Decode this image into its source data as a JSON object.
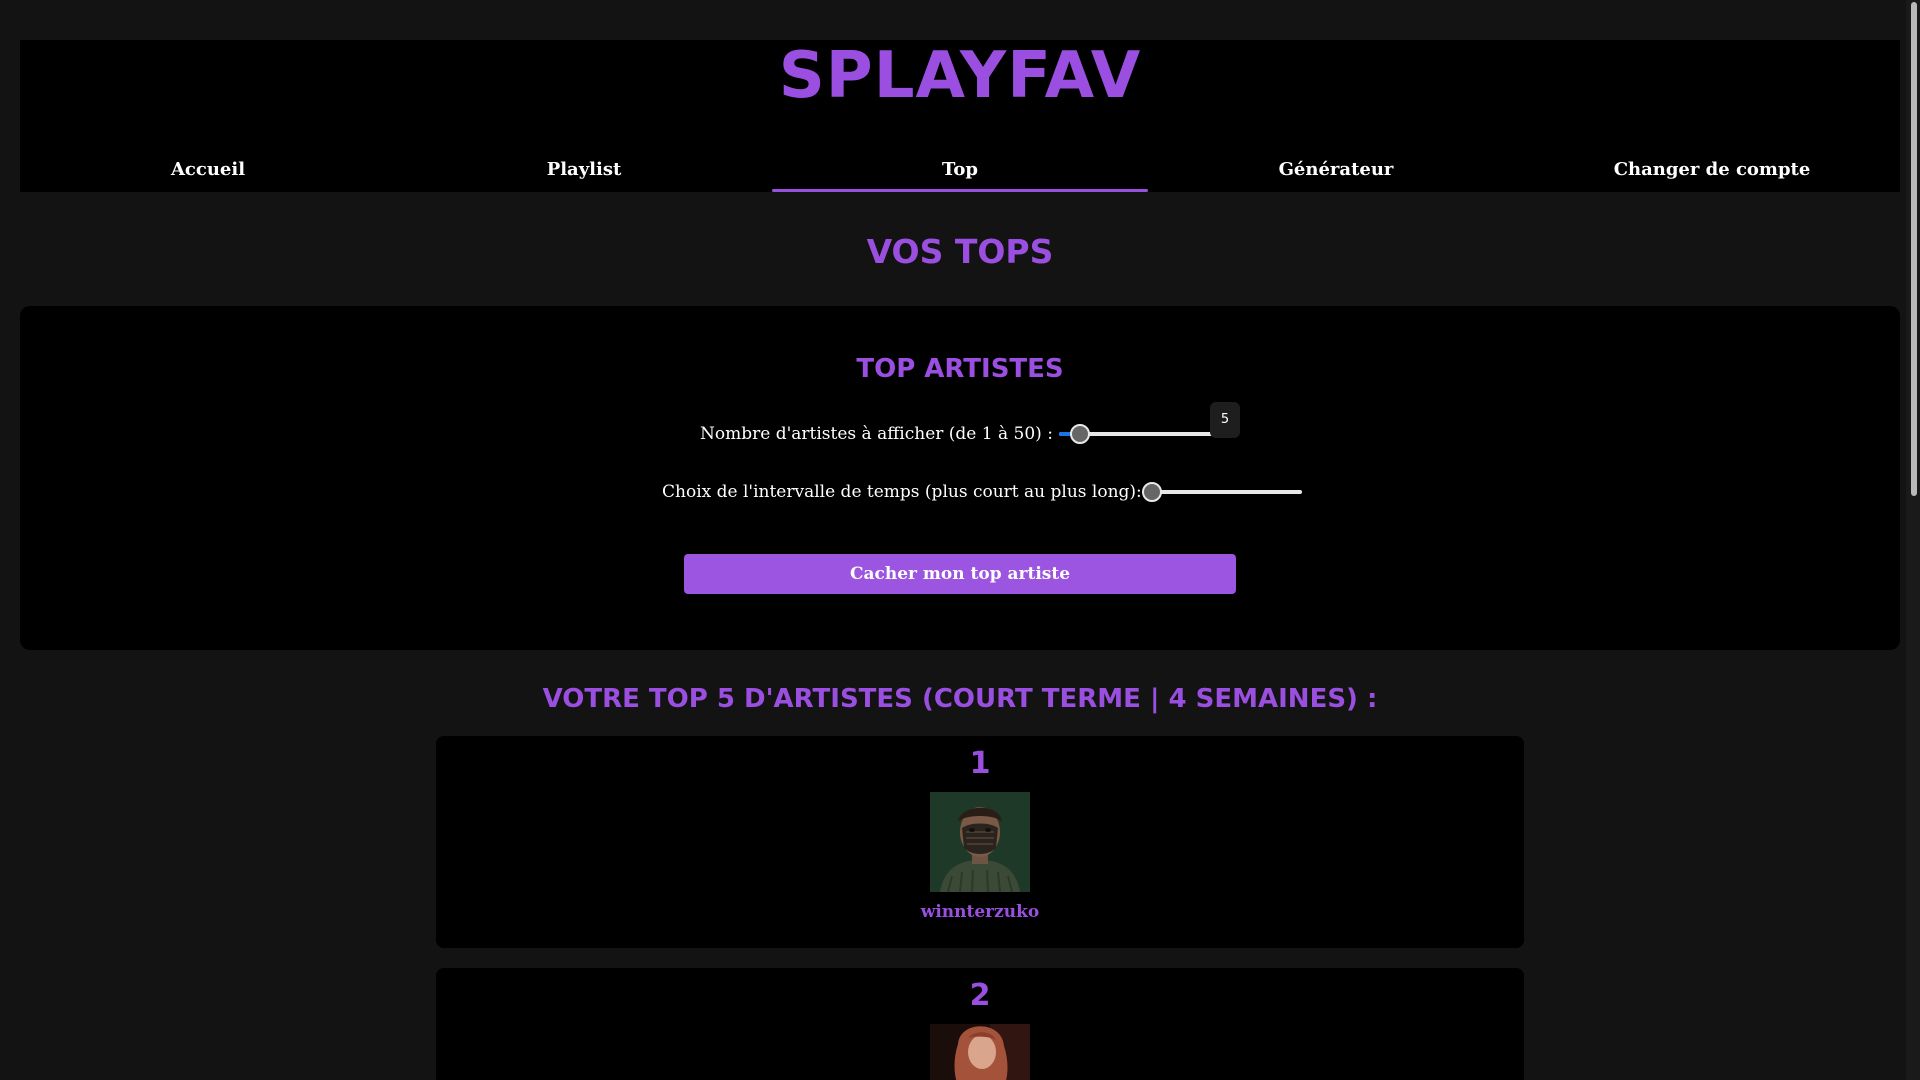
{
  "site": {
    "title": "SPLAYFAV"
  },
  "nav": {
    "items": [
      {
        "label": "Accueil"
      },
      {
        "label": "Playlist"
      },
      {
        "label": "Top"
      },
      {
        "label": "Générateur"
      },
      {
        "label": "Changer de compte"
      }
    ],
    "active": "Top"
  },
  "page": {
    "heading": "VOS TOPS"
  },
  "settings": {
    "title": "TOP ARTISTES",
    "count_label": "Nombre d'artistes à afficher (de 1 à 50) :",
    "count_value": "5",
    "count_min": 1,
    "count_max": 50,
    "interval_label": "Choix de l'intervalle de temps (plus court au plus long):",
    "interval_level": 0,
    "hide_button_label": "Cacher mon top artiste"
  },
  "results": {
    "heading": "VOTRE TOP 5 D'ARTISTES (COURT TERME | 4 SEMAINES) :",
    "artists": [
      {
        "rank": "1",
        "name": "winnterzuko",
        "image": "artist-portrait-masked-man"
      },
      {
        "rank": "2",
        "name": "",
        "image": "artist-portrait-red-hair-woman"
      }
    ]
  },
  "colors": {
    "accent": "#9b4fe0",
    "button": "#9b55e0",
    "background": "#131313",
    "card": "#000000"
  }
}
